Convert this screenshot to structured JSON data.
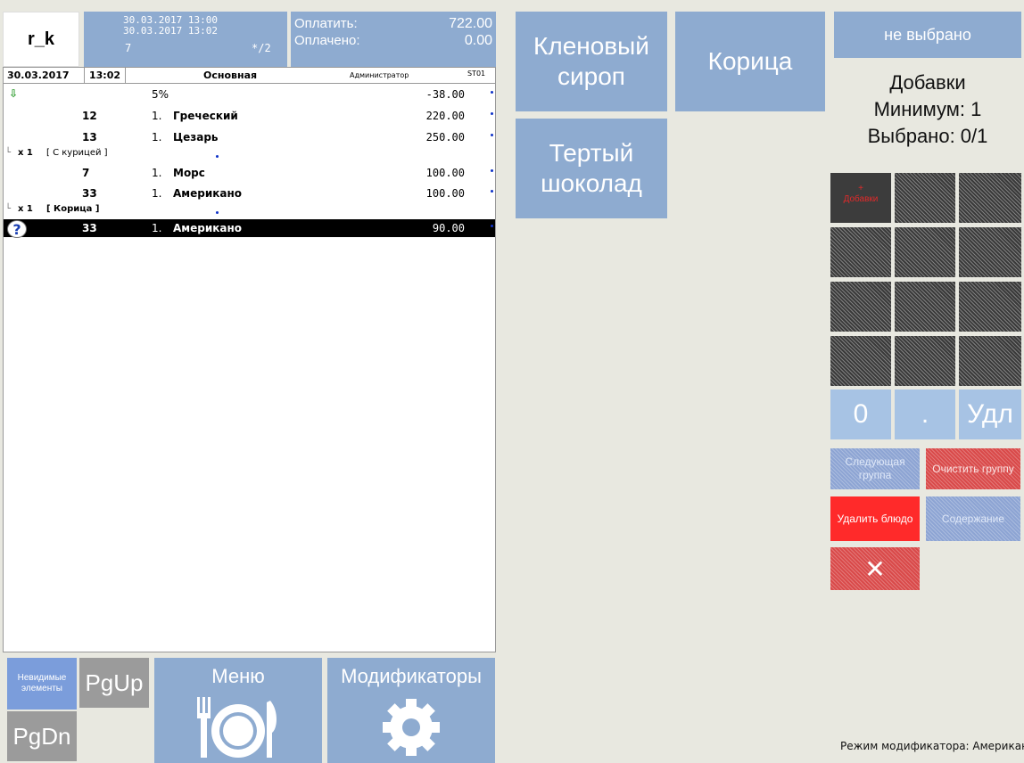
{
  "header": {
    "logo": "r_k",
    "date_open": "30.03.2017 13:00",
    "date_current": "30.03.2017 13:02",
    "table_no": "7",
    "guests": "*/2",
    "pay_label": "Оплатить:",
    "pay_value": "722.00",
    "paid_label": "Оплачено:",
    "paid_value": "0.00"
  },
  "order": {
    "date": "30.03.2017",
    "time": "13:02",
    "type": "Основная",
    "waiter": "Администратор",
    "station": "ST01",
    "discount": {
      "label": "5%",
      "value": "-38.00"
    },
    "items": [
      {
        "code": "12",
        "qty": "1.",
        "name": "Греческий",
        "price": "220.00"
      },
      {
        "code": "13",
        "qty": "1.",
        "name": "Цезарь",
        "price": "250.00"
      },
      {
        "code": "7",
        "qty": "1.",
        "name": "Морс",
        "price": "100.00"
      },
      {
        "code": "33",
        "qty": "1.",
        "name": "Американо",
        "price": "100.00"
      },
      {
        "code": "33",
        "qty": "1.",
        "name": "Американо",
        "price": "90.00"
      }
    ],
    "modifiers": [
      {
        "qty": "x 1",
        "name": "[ С курицей ]"
      },
      {
        "qty": "x 1",
        "name": "[ Корица ]"
      }
    ],
    "selected_icon": "?"
  },
  "bottom": {
    "invisible": "Невидимые элементы",
    "pgup": "PgUp",
    "pgdn": "PgDn",
    "menu": "Меню",
    "modifiers": "Модификаторы"
  },
  "modifier_buttons": {
    "maple": "Кленовый сироп",
    "cinnamon": "Корица",
    "chocolate": "Тертый шоколад"
  },
  "right": {
    "not_selected": "не выбрано",
    "group_title": "Добавки",
    "minimum": "Минимум: 1",
    "selected": "Выбрано: 0/1",
    "group_cell": "Добавки",
    "group_cell_mark": "+",
    "key_zero": "0",
    "key_dot": ".",
    "key_del": "Удл",
    "next_group": "Следующая группа",
    "clear_group": "Очистить группу",
    "delete_dish": "Удалить блюдо",
    "contents": "Содержание",
    "close": "✕",
    "status": "Режим модификатора: Американо"
  },
  "colors": {
    "accent": "#8eabd0",
    "red": "#ff2a2a",
    "selected_row": "#000000"
  }
}
